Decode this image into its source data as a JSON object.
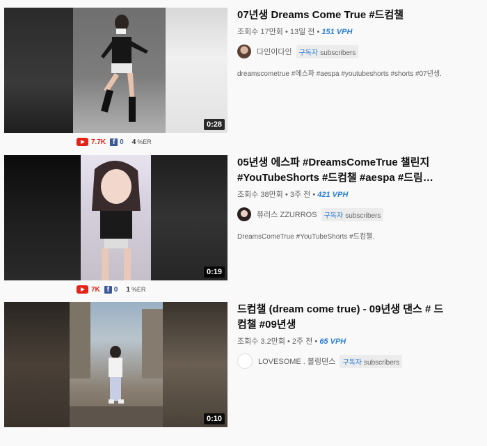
{
  "videos": [
    {
      "title": "07년생 Dreams Come True #드컴챌",
      "views": "조회수 17만회",
      "age": "13일 전",
      "vph": "151 VPH",
      "channel": "다인이다인",
      "sub_ko": "구독자",
      "sub_en": "subscribers",
      "desc": "dreamscometrue #에스파 #aespa #youtubeshorts #shorts #07년생.",
      "duration": "0:28",
      "yt_count": "7.7K",
      "fb_count": "0",
      "er_value": "4",
      "er_label": "%ER"
    },
    {
      "title": "05년생 에스파 #DreamsComeTrue 챌린지 #YouTubeShorts #드컴챌 #aespa #드림…",
      "views": "조회수 38만회",
      "age": "3주 전",
      "vph": "421 VPH",
      "channel": "쮸러스 ZZURROS",
      "sub_ko": "구독자",
      "sub_en": "subscribers",
      "desc": "DreamsComeTrue #YouTubeShorts #드컴챌.",
      "duration": "0:19",
      "yt_count": "7K",
      "fb_count": "0",
      "er_value": "1",
      "er_label": "%ER"
    },
    {
      "title": "드컴챌 (dream come true) - 09년생 댄스 # 드컴챌 #09년생",
      "views": "조회수 3.2만회",
      "age": "2주 전",
      "vph": "65 VPH",
      "channel": "LOVESOME . 볼링댄스",
      "sub_ko": "구독자",
      "sub_en": "subscribers",
      "duration": "0:10"
    }
  ],
  "colors": {
    "vph": "#2b7fd6",
    "youtube_red": "#e62117",
    "facebook_blue": "#3b5998"
  }
}
